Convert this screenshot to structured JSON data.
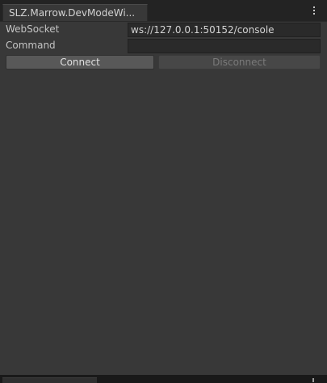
{
  "window": {
    "tab_title": "SLZ.Marrow.DevModeWi..."
  },
  "form": {
    "websocket_label": "WebSocket",
    "websocket_value": "ws://127.0.0.1:50152/console",
    "command_label": "Command",
    "command_value": ""
  },
  "buttons": {
    "connect_label": "Connect",
    "disconnect_label": "Disconnect",
    "disconnect_enabled": false
  },
  "colors": {
    "panel_bg": "#383838",
    "window_bg": "#191919",
    "field_bg": "#2a2a2a",
    "button_bg": "#585858"
  }
}
